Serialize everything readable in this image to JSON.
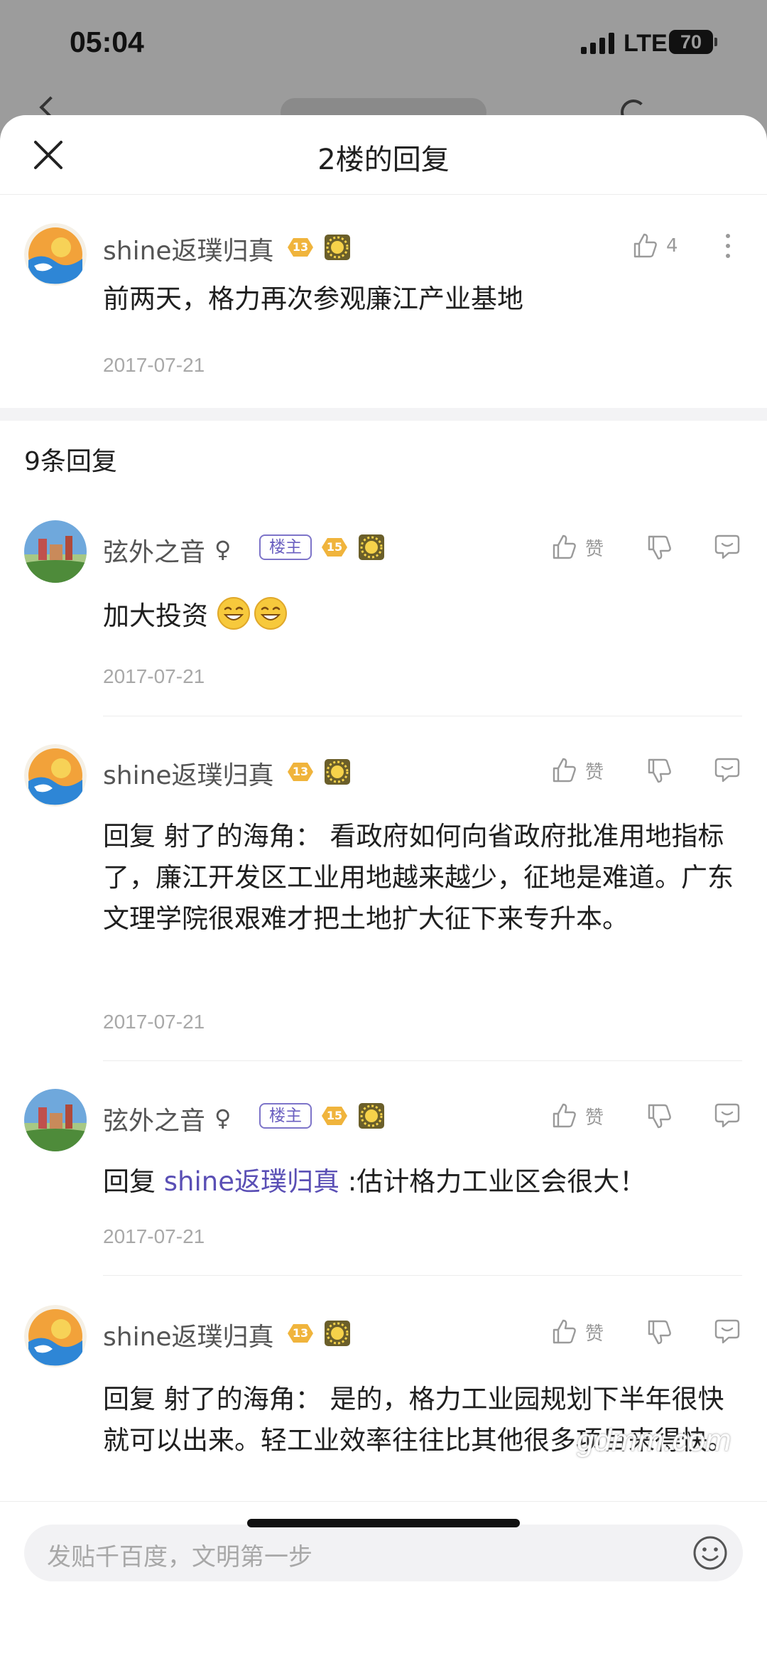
{
  "status_bar": {
    "time": "05:04",
    "network": "LTE",
    "battery": "70"
  },
  "sheet": {
    "title": "2楼的回复"
  },
  "main_post": {
    "username": "shine返璞归真",
    "level": "13",
    "like_count": "4",
    "content": "前两天，格力再次参观廉江产业基地",
    "date": "2017-07-21"
  },
  "reply_count": "9条回复",
  "like_label": "赞",
  "host_tag": "楼主",
  "gender_symbol": "♀",
  "replies": [
    {
      "username": "弦外之音",
      "level": "15",
      "content": "加大投资",
      "date": "2017-07-21"
    },
    {
      "username": "shine返璞归真",
      "level": "13",
      "prefix": "回复 射了的海角：",
      "content": " 看政府如何向省政府批准用地指标了，廉江开发区工业用地越来越少，征地是难道。广东文理学院很艰难才把土地扩大征下来专升本。",
      "date": "2017-07-21"
    },
    {
      "username": "弦外之音",
      "level": "15",
      "prefix": "回复 ",
      "mention": "shine返璞归真",
      "content": " :估计格力工业区会很大！",
      "date": "2017-07-21"
    },
    {
      "username": "shine返璞归真",
      "level": "13",
      "prefix": "回复 射了的海角：",
      "content": " 是的，格力工业园规划下半年很快就可以出来。轻工业效率往往比其他很多项目来得快。"
    }
  ],
  "input": {
    "placeholder": "发贴千百度，文明第一步"
  },
  "watermark": "gdmm.com",
  "colors": {
    "accent": "#6a5fc0",
    "badge_gold": "#f0b43c",
    "sun_badge": "#7a6a2a"
  }
}
